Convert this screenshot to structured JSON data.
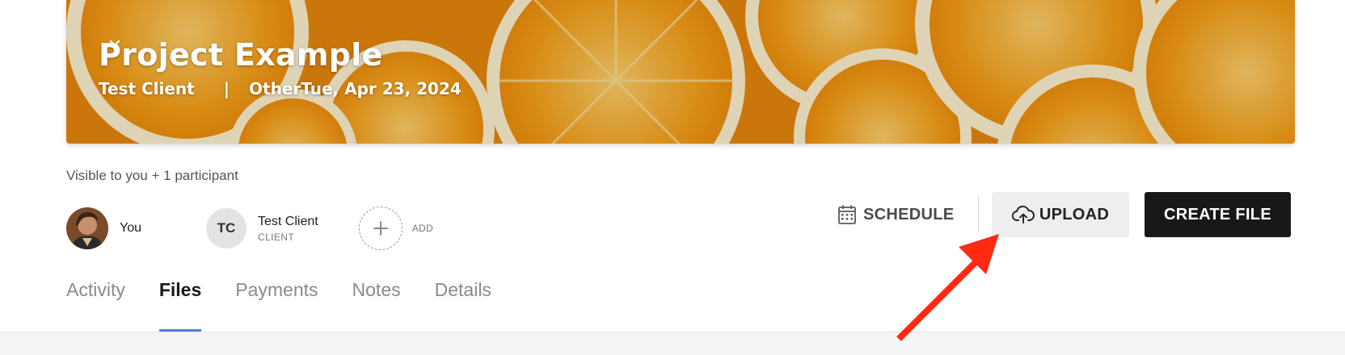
{
  "project": {
    "title": "Project Example",
    "client": "Test Client",
    "separator": "|",
    "type": "Other",
    "date": "Tue, Apr 23, 2024"
  },
  "participants": {
    "visible_text": "Visible to you + 1 participant",
    "you_label": "You",
    "client_initials": "TC",
    "client_name": "Test Client",
    "client_role": "CLIENT",
    "add_label": "ADD"
  },
  "actions": {
    "schedule_label": "SCHEDULE",
    "upload_label": "UPLOAD",
    "create_label": "CREATE FILE"
  },
  "tabs": [
    {
      "label": "Activity"
    },
    {
      "label": "Files",
      "active": true
    },
    {
      "label": "Payments"
    },
    {
      "label": "Notes"
    },
    {
      "label": "Details"
    }
  ],
  "colors": {
    "accent": "#5b7fdc",
    "create_button": "#16181a",
    "upload_button": "#eeeeee",
    "annotation_arrow": "#ff2a12"
  },
  "icons": {
    "schedule": "calendar-icon",
    "upload": "cloud-upload-icon",
    "add": "plus-icon",
    "type_dropdown": "chevron-down-icon"
  }
}
